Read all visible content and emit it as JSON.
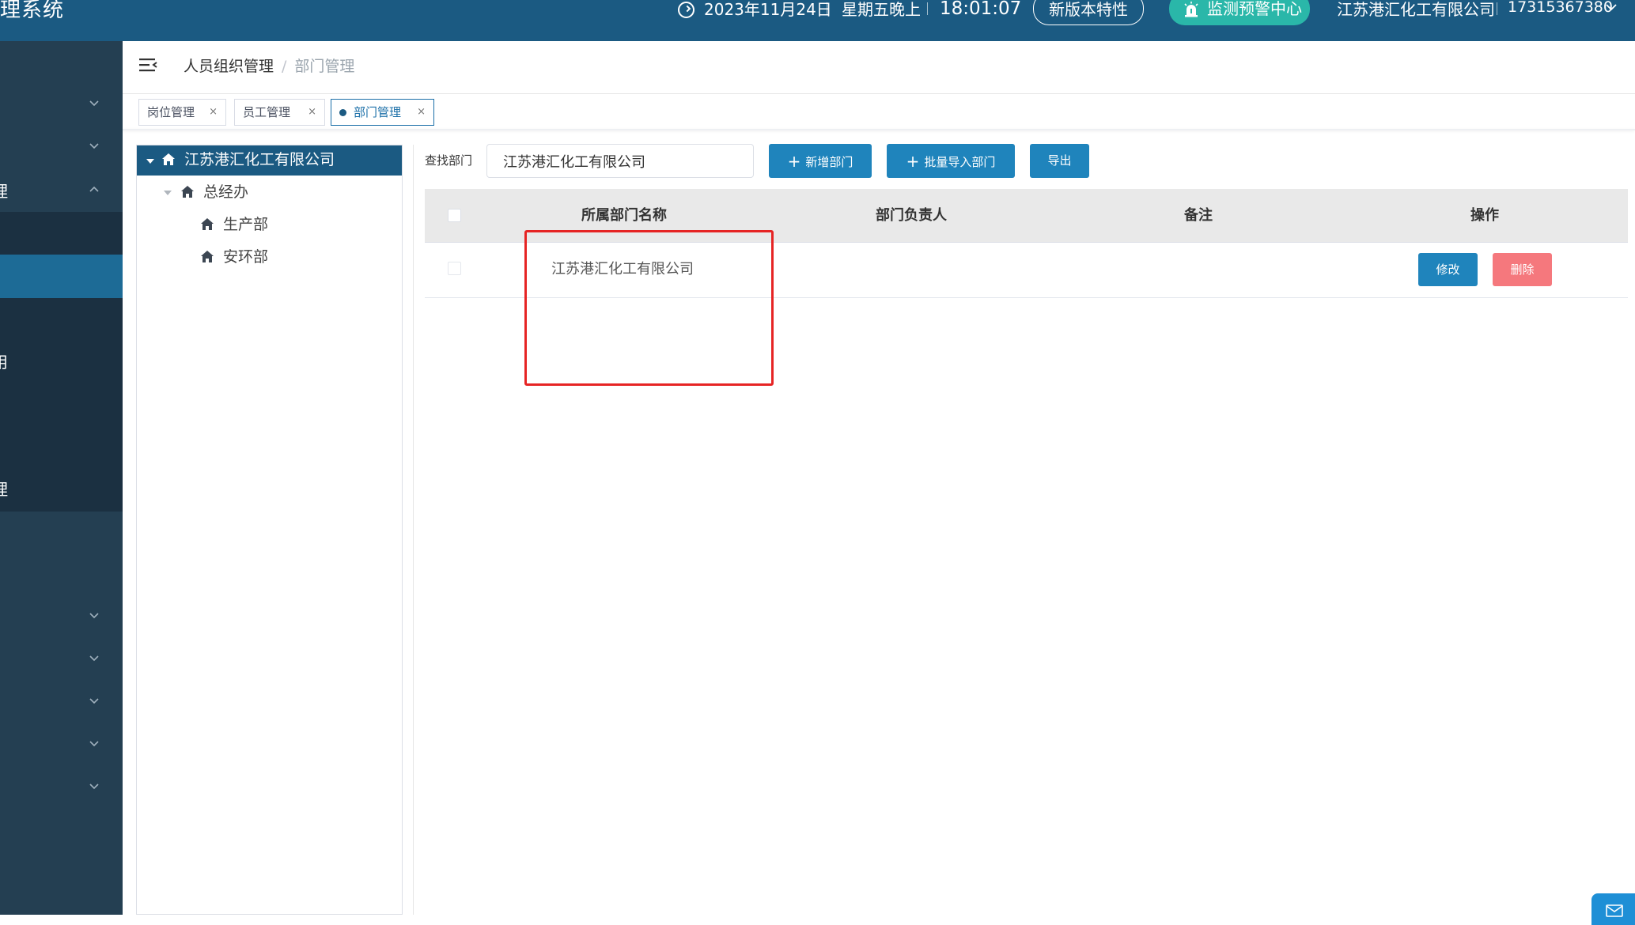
{
  "header": {
    "app_title": "理系统",
    "date": "2023年11月24日",
    "weekday_period": "星期五晚上",
    "time": "18:01:07",
    "new_features_label": "新版本特性",
    "alarm_center_label": "监测预警中心",
    "company": "江苏港汇化工有限公司",
    "phone": "17315367380"
  },
  "sidebar": {
    "items": [
      {
        "label": "",
        "has_chevron": true,
        "chevron": "down"
      },
      {
        "label": "",
        "has_chevron": true,
        "chevron": "down"
      },
      {
        "label": "理",
        "has_chevron": true,
        "chevron": "up"
      },
      {
        "label": "",
        "state": "sub-item"
      },
      {
        "label": "",
        "state": "active"
      },
      {
        "label": "用"
      },
      {
        "label": "理"
      },
      {
        "label": "",
        "has_chevron": true,
        "chevron": "down"
      },
      {
        "label": "",
        "has_chevron": true,
        "chevron": "down"
      },
      {
        "label": "",
        "has_chevron": true,
        "chevron": "down"
      },
      {
        "label": "",
        "has_chevron": true,
        "chevron": "down"
      },
      {
        "label": "",
        "has_chevron": true,
        "chevron": "down"
      }
    ]
  },
  "breadcrumb": {
    "parent": "人员组织管理",
    "separator": "/",
    "current": "部门管理"
  },
  "tabs": [
    {
      "label": "岗位管理",
      "close": "×",
      "active": false
    },
    {
      "label": "员工管理",
      "close": "×",
      "active": false
    },
    {
      "label": "部门管理",
      "close": "×",
      "active": true
    }
  ],
  "tree": {
    "root": "江苏港汇化工有限公司",
    "children": [
      {
        "label": "总经办",
        "children": [
          {
            "label": "生产部"
          },
          {
            "label": "安环部"
          }
        ]
      }
    ]
  },
  "toolbar": {
    "search_label": "查找部门",
    "search_value": "江苏港汇化工有限公司",
    "add_button": "新增部门",
    "import_button": "批量导入部门",
    "export_button": "导出",
    "plus_glyph": "+"
  },
  "table": {
    "columns": [
      "所属部门名称",
      "部门负责人",
      "备注",
      "操作"
    ],
    "rows": [
      {
        "department": "江苏港汇化工有限公司",
        "manager": "",
        "remark": "",
        "edit_label": "修改",
        "delete_label": "删除"
      }
    ]
  },
  "colors": {
    "topbar": "#1b5a82",
    "sidebar": "#243f52",
    "sidebar_active": "#1d6b96",
    "primary": "#1f84bc",
    "danger": "#f5787d",
    "alarm": "#2ab7a9",
    "highlight": "#e62424"
  },
  "icons": [
    "clock-icon",
    "alarm-icon",
    "chevron-down-icon",
    "hamburger-icon",
    "home-icon",
    "caret-down-icon",
    "feedback-icon"
  ]
}
